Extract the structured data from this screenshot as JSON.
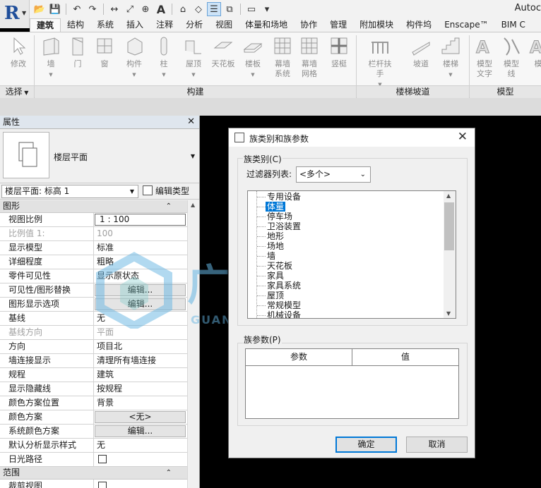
{
  "app_title": "Autoc",
  "quick_access": {
    "icons": [
      "open-icon",
      "save-icon",
      "undo-icon",
      "redo-icon",
      "measure-icon",
      "dimension-icon",
      "tag-icon",
      "text-icon",
      "3d-view-icon",
      "section-icon",
      "thin-lines-icon",
      "close-hidden-icon",
      "switch-windows-icon",
      "customize-icon"
    ]
  },
  "ribbon_tabs": [
    "建筑",
    "结构",
    "系统",
    "插入",
    "注释",
    "分析",
    "视图",
    "体量和场地",
    "协作",
    "管理",
    "附加模块",
    "构件坞",
    "Enscape™",
    "BIM C"
  ],
  "active_tab": 0,
  "ribbon": {
    "select_label": "选择",
    "modify": "修改",
    "build_tools": [
      {
        "label": "墙",
        "caret": true
      },
      {
        "label": "门"
      },
      {
        "label": "窗"
      },
      {
        "label": "构件",
        "caret": true
      },
      {
        "label": "柱",
        "caret": true
      },
      {
        "label": "屋顶",
        "caret": true
      },
      {
        "label": "天花板"
      },
      {
        "label": "楼板",
        "caret": true
      },
      {
        "label": "幕墙\n系统"
      },
      {
        "label": "幕墙\n网格"
      },
      {
        "label": "竖梃"
      }
    ],
    "build_panel": "构建",
    "stair_tools": [
      {
        "label": "栏杆扶手",
        "caret": true
      },
      {
        "label": "坡道"
      },
      {
        "label": "楼梯",
        "caret": true
      }
    ],
    "stair_panel": "楼梯坡道",
    "model_tools": [
      {
        "label": "模型\n文字"
      },
      {
        "label": "模型\n线"
      },
      {
        "label": "模"
      }
    ],
    "model_panel": "模型"
  },
  "properties": {
    "title": "属性",
    "type_name": "楼层平面",
    "instance_selector": "楼层平面: 标高 1",
    "edit_type": "编辑类型",
    "group_graphics": "图形",
    "rows": [
      {
        "k": "视图比例",
        "v": "1 : 100",
        "style": "input"
      },
      {
        "k": "比例值 1:",
        "v": "100",
        "style": "dis"
      },
      {
        "k": "显示模型",
        "v": "标准"
      },
      {
        "k": "详细程度",
        "v": "粗略"
      },
      {
        "k": "零件可见性",
        "v": "显示原状态"
      },
      {
        "k": "可见性/图形替换",
        "v": "编辑...",
        "style": "btn"
      },
      {
        "k": "图形显示选项",
        "v": "编辑...",
        "style": "btn"
      },
      {
        "k": "基线",
        "v": "无"
      },
      {
        "k": "基线方向",
        "v": "平面",
        "style": "dis"
      },
      {
        "k": "方向",
        "v": "项目北"
      },
      {
        "k": "墙连接显示",
        "v": "清理所有墙连接"
      },
      {
        "k": "规程",
        "v": "建筑"
      },
      {
        "k": "显示隐藏线",
        "v": "按规程"
      },
      {
        "k": "颜色方案位置",
        "v": "背景"
      },
      {
        "k": "颜色方案",
        "v": "<无>",
        "style": "btn"
      },
      {
        "k": "系统颜色方案",
        "v": "编辑...",
        "style": "btn"
      },
      {
        "k": "默认分析显示样式",
        "v": "无"
      },
      {
        "k": "日光路径",
        "v": "",
        "style": "chk"
      }
    ],
    "group_extents": "范围",
    "last_row": {
      "k": "裁剪视图",
      "v": "",
      "style": "chk"
    }
  },
  "dialog": {
    "title": "族类别和族参数",
    "family_category_label": "族类别(C)",
    "filter_label": "过滤器列表:",
    "filter_value": "<多个>",
    "categories": [
      "专用设备",
      "体量",
      "停车场",
      "卫浴装置",
      "地形",
      "场地",
      "墙",
      "天花板",
      "家具",
      "家具系统",
      "屋顶",
      "常规模型",
      "机械设备"
    ],
    "selected_index": 1,
    "family_params_label": "族参数(P)",
    "param_header": "参数",
    "value_header": "值",
    "ok": "确定",
    "cancel": "取消"
  },
  "watermark": {
    "cn": "广筑咨询",
    "en": "GUANGZHU CONSULTATION"
  }
}
